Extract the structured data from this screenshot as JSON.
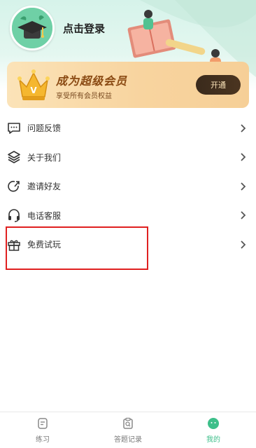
{
  "header": {
    "login_text": "点击登录",
    "avatar_icon": "graduation-cap-avatar",
    "bg_color": "#d6f3ea"
  },
  "vip": {
    "title": "成为超级会员",
    "subtitle": "享受所有会员权益",
    "button_label": "开通",
    "crown_letter": "V",
    "colors": {
      "card": "#f8d49f",
      "title": "#8a4a13",
      "button": "#3a2a1c"
    }
  },
  "menu": {
    "items": [
      {
        "label": "问题反馈",
        "icon": "feedback-icon"
      },
      {
        "label": "关于我们",
        "icon": "layers-icon"
      },
      {
        "label": "邀请好友",
        "icon": "share-arrow-icon"
      },
      {
        "label": "电话客服",
        "icon": "headset-icon"
      },
      {
        "label": "免费试玩",
        "icon": "gift-icon"
      }
    ]
  },
  "tabbar": {
    "active_color": "#3dbf8a",
    "tabs": [
      {
        "label": "练习",
        "icon": "practice-icon",
        "active": false
      },
      {
        "label": "答题记录",
        "icon": "record-icon",
        "active": false
      },
      {
        "label": "我的",
        "icon": "profile-face-icon",
        "active": true
      }
    ]
  }
}
